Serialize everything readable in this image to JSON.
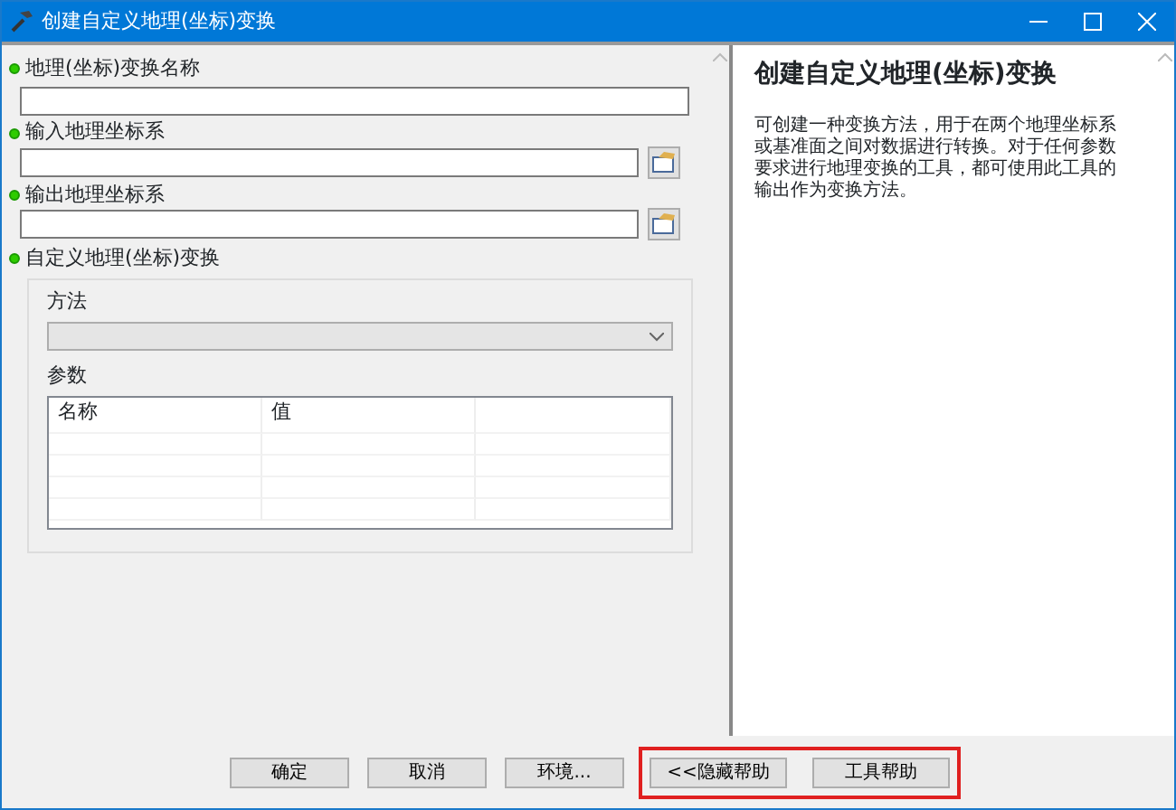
{
  "window": {
    "title": "创建自定义地理(坐标)变换"
  },
  "parameters": [
    {
      "kind": "text",
      "label": "地理(坐标)变换名称"
    },
    {
      "kind": "browse",
      "label": "输入地理坐标系"
    },
    {
      "kind": "browse",
      "label": "输出地理坐标系"
    },
    {
      "kind": "group",
      "label": "自定义地理(坐标)变换",
      "method_label": "方法",
      "params_label": "参数",
      "columns": [
        "名称",
        "值"
      ]
    }
  ],
  "help": {
    "title": "创建自定义地理(坐标)变换",
    "text": "可创建一种变换方法，用于在两个地理坐标系或基准面之间对数据进行转换。对于任何参数要求进行地理变换的工具，都可使用此工具的输出作为变换方法。"
  },
  "buttons": [
    {
      "label": "确定",
      "highlighted": false
    },
    {
      "label": "取消",
      "highlighted": false
    },
    {
      "label": "环境...",
      "highlighted": false
    },
    {
      "label": "<<隐藏帮助",
      "highlighted": true
    },
    {
      "label": "工具帮助",
      "highlighted": true
    }
  ]
}
